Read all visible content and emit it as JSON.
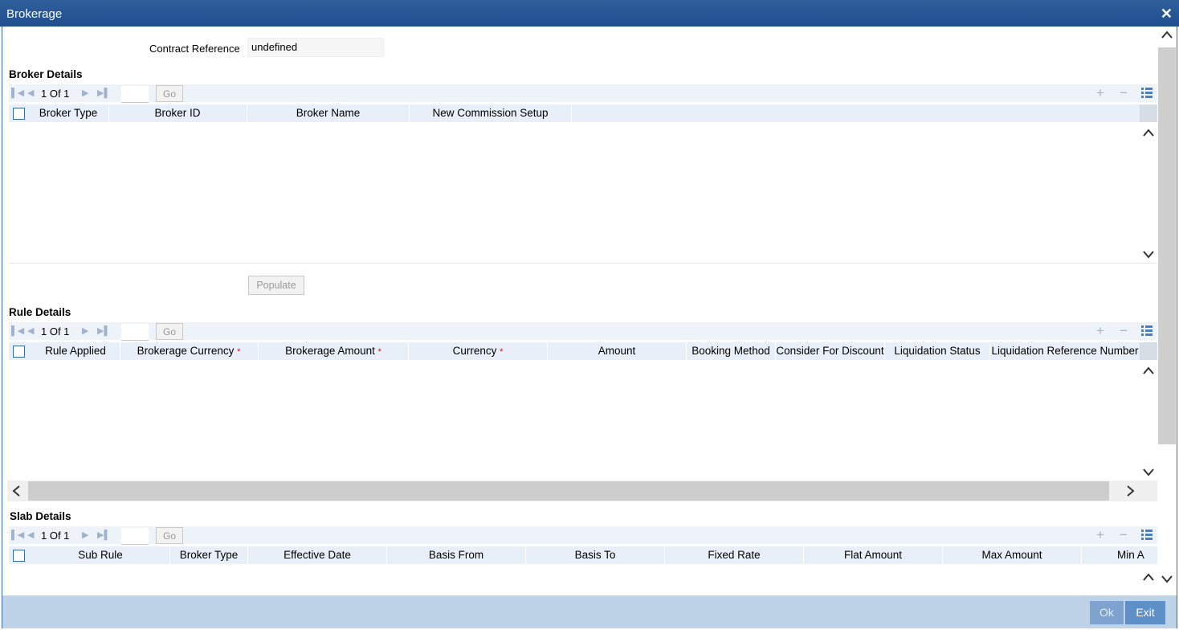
{
  "window": {
    "title": "Brokerage"
  },
  "contract": {
    "label": "Contract Reference",
    "value": "undefined"
  },
  "broker_details": {
    "title": "Broker Details",
    "pager": {
      "count": "1 Of 1",
      "go": "Go"
    },
    "columns": [
      "Broker Type",
      "Broker ID",
      "Broker Name",
      "New Commission Setup"
    ]
  },
  "populate_label": "Populate",
  "rule_details": {
    "title": "Rule Details",
    "pager": {
      "count": "1 Of 1",
      "go": "Go"
    },
    "columns": [
      "Rule Applied",
      "Brokerage Currency",
      "Brokerage Amount",
      "Currency",
      "Amount",
      "Booking Method",
      "Consider For Discount",
      "Liquidation Status",
      "Liquidation Reference Number"
    ],
    "required_mark": "*"
  },
  "slab_details": {
    "title": "Slab Details",
    "pager": {
      "count": "1 Of 1",
      "go": "Go"
    },
    "columns": [
      "Sub Rule",
      "Broker Type",
      "Effective Date",
      "Basis From",
      "Basis To",
      "Fixed Rate",
      "Flat Amount",
      "Max Amount",
      "Min A"
    ]
  },
  "footer": {
    "ok_label": "Ok",
    "exit_label": "Exit"
  },
  "colors": {
    "titlebar": "#1f4f8f",
    "footer": "#bfd3e8",
    "button": "#5e8fc6",
    "header_row": "#e8eff8"
  },
  "icons": [
    "first-page-icon",
    "prev-page-icon",
    "next-page-icon",
    "last-page-icon",
    "add-row-icon",
    "delete-row-icon",
    "single-view-icon",
    "close-icon",
    "scroll-up-icon",
    "scroll-down-icon",
    "scroll-left-icon",
    "scroll-right-icon"
  ]
}
